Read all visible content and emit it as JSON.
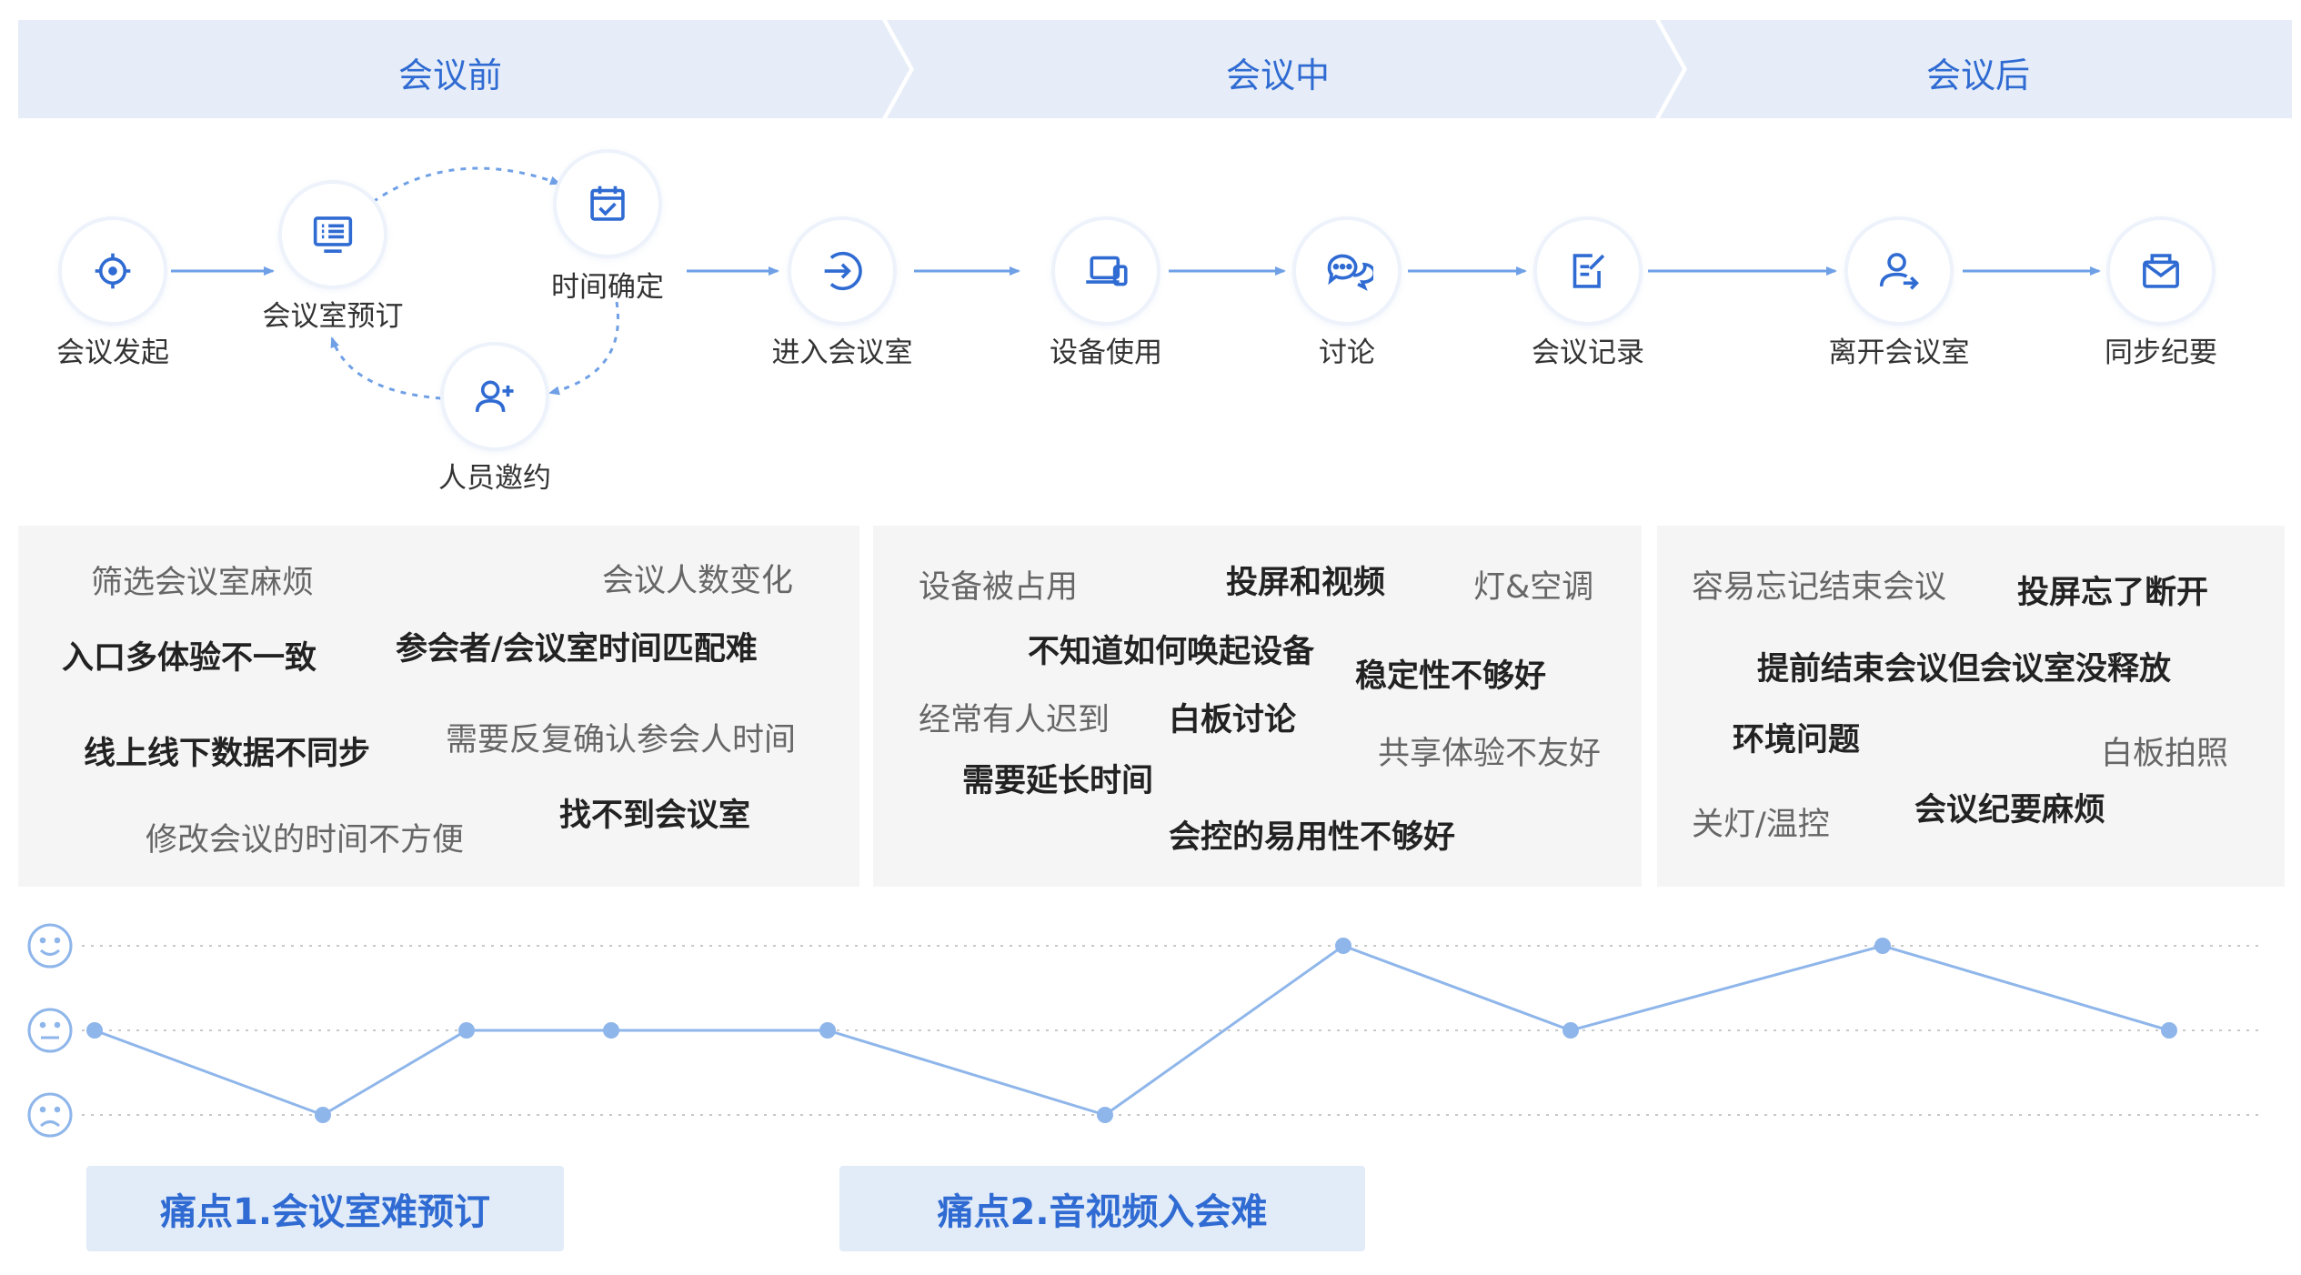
{
  "phases": [
    {
      "label": "会议前"
    },
    {
      "label": "会议中"
    },
    {
      "label": "会议后"
    }
  ],
  "steps": [
    {
      "label": "会议发起",
      "icon": "crosshair-icon"
    },
    {
      "label": "会议室预订",
      "icon": "monitor-list-icon"
    },
    {
      "label": "时间确定",
      "icon": "calendar-check-icon"
    },
    {
      "label": "人员邀约",
      "icon": "add-user-icon"
    },
    {
      "label": "进入会议室",
      "icon": "enter-arrow-icon"
    },
    {
      "label": "设备使用",
      "icon": "laptop-device-icon"
    },
    {
      "label": "讨论",
      "icon": "chat-bubbles-icon"
    },
    {
      "label": "会议记录",
      "icon": "note-edit-icon"
    },
    {
      "label": "离开会议室",
      "icon": "user-leave-icon"
    },
    {
      "label": "同步纪要",
      "icon": "mail-sync-icon"
    }
  ],
  "pain_points": {
    "before": [
      "筛选会议室麻烦",
      "会议人数变化",
      "入口多体验不一致",
      "参会者/会议室时间匹配难",
      "线上线下数据不同步",
      "需要反复确认参会人时间",
      "找不到会议室",
      "修改会议的时间不方便"
    ],
    "during": [
      "设备被占用",
      "投屏和视频",
      "灯&空调",
      "不知道如何唤起设备",
      "稳定性不够好",
      "经常有人迟到",
      "白板讨论",
      "共享体验不友好",
      "需要延长时间",
      "会控的易用性不够好"
    ],
    "after": [
      "容易忘记结束会议",
      "投屏忘了断开",
      "提前结束会议但会议室没释放",
      "环境问题",
      "白板拍照",
      "关灯/温控",
      "会议纪要麻烦"
    ]
  },
  "emotion": {
    "levels": [
      "happy",
      "neutral",
      "sad"
    ],
    "icons": [
      "smile-face-icon",
      "neutral-face-icon",
      "sad-face-icon"
    ],
    "values": [
      0,
      -1,
      0,
      0,
      0,
      -1,
      1,
      0,
      1,
      0
    ],
    "line_color": "#8fb6ea",
    "point_color": "#8fb6ea"
  },
  "callouts": [
    {
      "label": "痛点1.会议室难预订"
    },
    {
      "label": "痛点2.音视频入会难"
    }
  ],
  "colors": {
    "phase_bg": "#e6edf8",
    "phase_text": "#2f6bd2",
    "icon": "#2f6bd2",
    "arrow": "#6fa0e6",
    "panel_bg": "#f5f5f5"
  }
}
